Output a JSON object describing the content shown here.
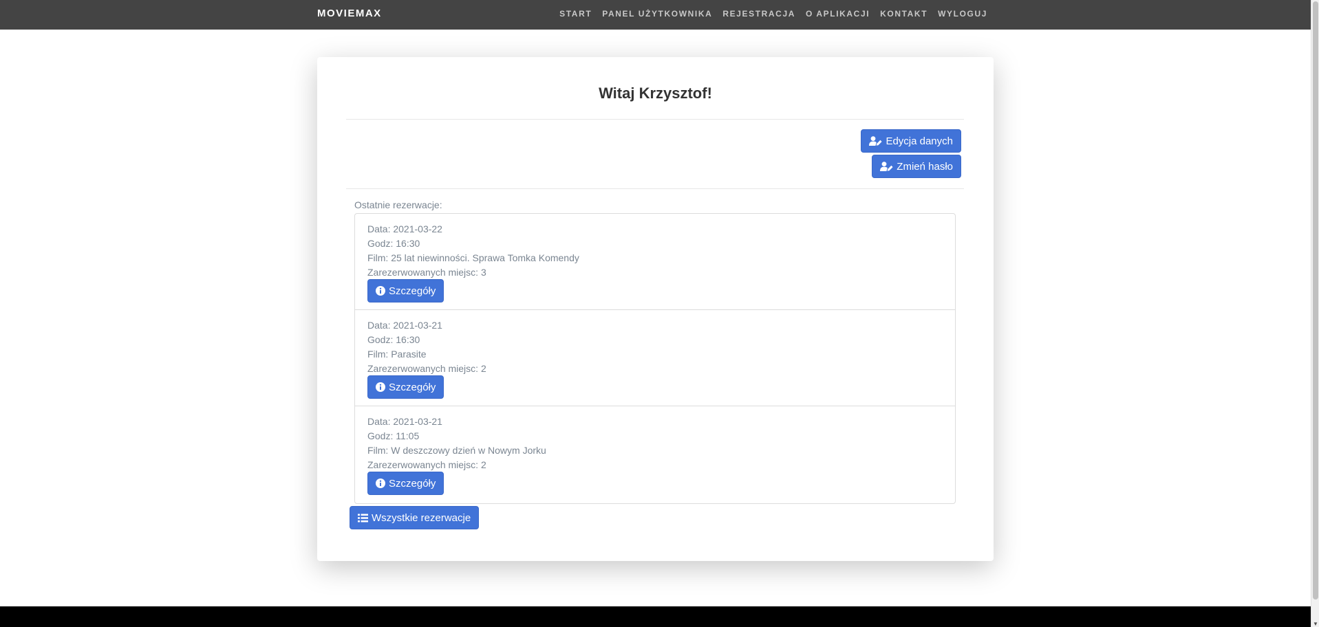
{
  "navbar": {
    "brand": "MOVIEMAX",
    "links": [
      "START",
      "PANEL UŻYTKOWNIKA",
      "REJESTRACJA",
      "O APLIKACJI",
      "KONTAKT",
      "WYLOGUJ"
    ]
  },
  "card": {
    "title": "Witaj Krzysztof!",
    "edit_button": "Edycja danych",
    "password_button": "Zmień hasło",
    "section_label": "Ostatnie rezerwacje:",
    "reservations": [
      {
        "date": "Data: 2021-03-22",
        "time": "Godz: 16:30",
        "film": "Film: 25 lat niewinności. Sprawa Tomka Komendy",
        "seats": "Zarezerwowanych miejsc: 3",
        "details_button": "Szczegóły"
      },
      {
        "date": "Data: 2021-03-21",
        "time": "Godz: 16:30",
        "film": "Film: Parasite",
        "seats": "Zarezerwowanych miejsc: 2",
        "details_button": "Szczegóły"
      },
      {
        "date": "Data: 2021-03-21",
        "time": "Godz: 11:05",
        "film": "Film: W deszczowy dzień w Nowym Jorku",
        "seats": "Zarezerwowanych miejsc: 2",
        "details_button": "Szczegóły"
      }
    ],
    "all_reservations_button": "Wszystkie rezerwacje"
  },
  "colors": {
    "navbar": "#444444",
    "accent": "#4173d8",
    "footer": "#000000"
  }
}
